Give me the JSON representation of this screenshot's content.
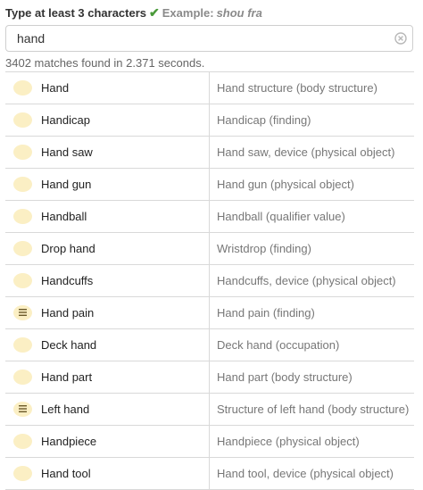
{
  "hint": {
    "label": "Type at least 3 characters",
    "example_label": "Example:",
    "example_text": "shou fra"
  },
  "search": {
    "value": "hand",
    "placeholder": ""
  },
  "stats": "3402 matches found in 2.371 seconds.",
  "colors": {
    "badge": "#fbefc4",
    "check": "#4a9a3a",
    "border": "#d9d9d9"
  },
  "results": [
    {
      "term": "Hand",
      "description": "Hand structure (body structure)",
      "icon": "badge-icon"
    },
    {
      "term": "Handicap",
      "description": "Handicap (finding)",
      "icon": "badge-icon"
    },
    {
      "term": "Hand saw",
      "description": "Hand saw, device (physical object)",
      "icon": "badge-icon"
    },
    {
      "term": "Hand gun",
      "description": "Hand gun (physical object)",
      "icon": "badge-icon"
    },
    {
      "term": "Handball",
      "description": "Handball (qualifier value)",
      "icon": "badge-icon"
    },
    {
      "term": "Drop hand",
      "description": "Wristdrop (finding)",
      "icon": "badge-icon"
    },
    {
      "term": "Handcuffs",
      "description": "Handcuffs, device (physical object)",
      "icon": "badge-icon"
    },
    {
      "term": "Hand pain",
      "description": "Hand pain (finding)",
      "icon": "menu-lines-icon"
    },
    {
      "term": "Deck hand",
      "description": "Deck hand (occupation)",
      "icon": "badge-icon"
    },
    {
      "term": "Hand part",
      "description": "Hand part (body structure)",
      "icon": "badge-icon"
    },
    {
      "term": "Left hand",
      "description": "Structure of left hand (body structure)",
      "icon": "menu-lines-icon"
    },
    {
      "term": "Handpiece",
      "description": "Handpiece (physical object)",
      "icon": "badge-icon"
    },
    {
      "term": "Hand tool",
      "description": "Hand tool, device (physical object)",
      "icon": "badge-icon"
    }
  ]
}
